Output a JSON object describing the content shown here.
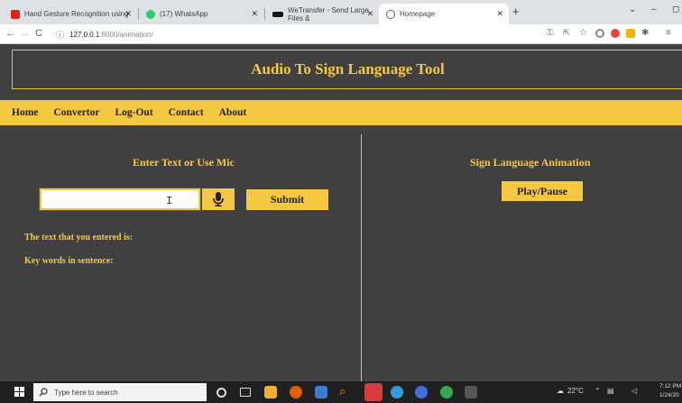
{
  "browser": {
    "tabs": [
      {
        "title": "Hand Gesture Recognition using",
        "favicon": "youtube-icon",
        "color": "#e62117"
      },
      {
        "title": "(17) WhatsApp",
        "favicon": "whatsapp-icon",
        "color": "#25d366"
      },
      {
        "title": "WeTransfer - Send Large Files &",
        "favicon": "wetransfer-icon",
        "color": "#17181a"
      },
      {
        "title": "Homepage",
        "favicon": "globe-icon",
        "color": "#5f6368"
      }
    ],
    "new_tab_label": "+",
    "url_host": "127.0.0.1",
    "url_path": ":8000/animation/"
  },
  "page": {
    "title": "Audio To Sign Language Tool",
    "nav": [
      "Home",
      "Convertor",
      "Log-Out",
      "Contact",
      "About"
    ],
    "left": {
      "title": "Enter Text or Use Mic",
      "input_value": "",
      "submit_label": "Submit",
      "entered_text_label": "The text that you entered is:",
      "keywords_label": "Key words in sentence:"
    },
    "right": {
      "title": "Sign Language Animation",
      "play_label": "Play/Pause"
    }
  },
  "taskbar": {
    "search_placeholder": "Type here to search",
    "weather": "22°C",
    "time": "7:12 PM",
    "date": "1/24/20"
  },
  "colors": {
    "accent": "#f5c842",
    "background": "#404040"
  }
}
